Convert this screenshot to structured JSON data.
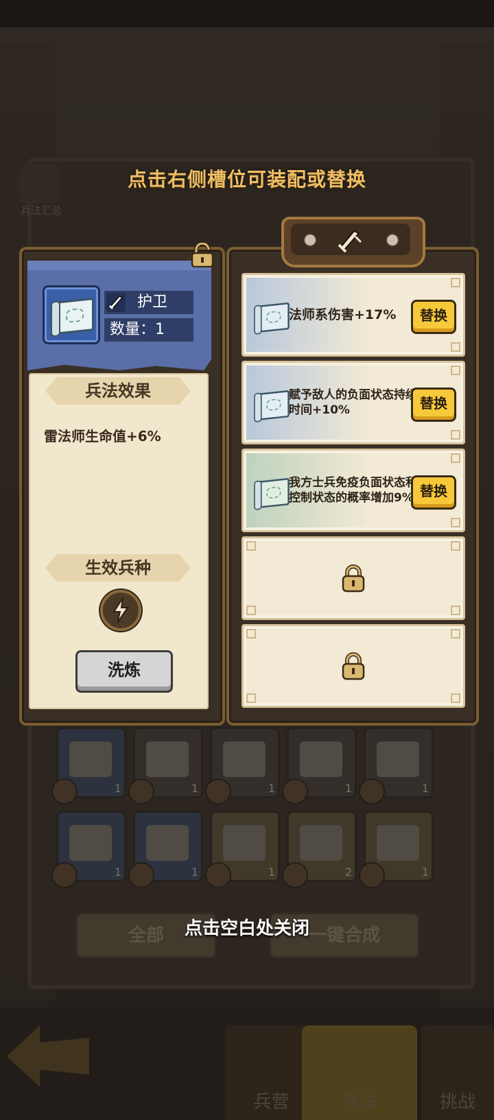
{
  "hint_top": "点击右侧槽位可装配或替换",
  "hint_bottom": "点击空白处关闭",
  "background": {
    "left_menu_label": "兵法汇总",
    "grid_counts": [
      "1",
      "1",
      "1",
      "1",
      "1",
      "1",
      "1",
      "1",
      "2",
      "1"
    ],
    "buttons": [
      "全部",
      "一键合成"
    ],
    "nav_tabs": [
      "兵营",
      "兵法",
      "挑战"
    ],
    "active_tab": "兵法"
  },
  "detail": {
    "name": "护卫",
    "quantity": "数量：1",
    "effect_title": "兵法效果",
    "effect_text": "雷法师生命值+6%",
    "unit_type_title": "生效兵种",
    "unit_type_icon": "lightning-icon",
    "refine_label": "洗炼"
  },
  "slots": [
    {
      "text": "法师系伤害+17%",
      "tone": "blue",
      "button": "替换"
    },
    {
      "text": "赋予敌人的负面状态持续时间+10%",
      "tone": "blue",
      "button": "替换"
    },
    {
      "text": "我方士兵免疫负面状态和控制状态的概率增加9%",
      "tone": "green",
      "button": "替换"
    },
    {
      "locked": true
    },
    {
      "locked": true
    }
  ],
  "colors": {
    "accent_gold": "#f0be63",
    "replace_button": "#f7c93a",
    "header_blue": "#5a6ea8"
  }
}
